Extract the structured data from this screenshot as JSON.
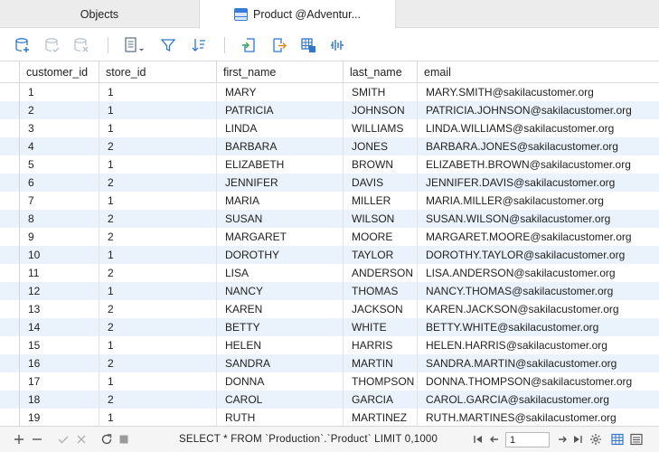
{
  "tabs": [
    {
      "label": "Objects",
      "active": false
    },
    {
      "label": "Product @Adventur...",
      "active": true
    }
  ],
  "toolbar": {
    "icons": [
      "add-record-icon",
      "save-record-icon",
      "discard-record-icon",
      "text-format-icon",
      "filter-icon",
      "sort-icon",
      "import-icon",
      "export-icon",
      "data-generator-icon",
      "chart-icon"
    ]
  },
  "table": {
    "columns": [
      "customer_id",
      "store_id",
      "first_name",
      "last_name",
      "email"
    ],
    "rows": [
      [
        "1",
        "1",
        "MARY",
        "SMITH",
        "MARY.SMITH@sakilacustomer.org"
      ],
      [
        "2",
        "1",
        "PATRICIA",
        "JOHNSON",
        "PATRICIA.JOHNSON@sakilacustomer.org"
      ],
      [
        "3",
        "1",
        "LINDA",
        "WILLIAMS",
        "LINDA.WILLIAMS@sakilacustomer.org"
      ],
      [
        "4",
        "2",
        "BARBARA",
        "JONES",
        "BARBARA.JONES@sakilacustomer.org"
      ],
      [
        "5",
        "1",
        "ELIZABETH",
        "BROWN",
        "ELIZABETH.BROWN@sakilacustomer.org"
      ],
      [
        "6",
        "2",
        "JENNIFER",
        "DAVIS",
        "JENNIFER.DAVIS@sakilacustomer.org"
      ],
      [
        "7",
        "1",
        "MARIA",
        "MILLER",
        "MARIA.MILLER@sakilacustomer.org"
      ],
      [
        "8",
        "2",
        "SUSAN",
        "WILSON",
        "SUSAN.WILSON@sakilacustomer.org"
      ],
      [
        "9",
        "2",
        "MARGARET",
        "MOORE",
        "MARGARET.MOORE@sakilacustomer.org"
      ],
      [
        "10",
        "1",
        "DOROTHY",
        "TAYLOR",
        "DOROTHY.TAYLOR@sakilacustomer.org"
      ],
      [
        "11",
        "2",
        "LISA",
        "ANDERSON",
        "LISA.ANDERSON@sakilacustomer.org"
      ],
      [
        "12",
        "1",
        "NANCY",
        "THOMAS",
        "NANCY.THOMAS@sakilacustomer.org"
      ],
      [
        "13",
        "2",
        "KAREN",
        "JACKSON",
        "KAREN.JACKSON@sakilacustomer.org"
      ],
      [
        "14",
        "2",
        "BETTY",
        "WHITE",
        "BETTY.WHITE@sakilacustomer.org"
      ],
      [
        "15",
        "1",
        "HELEN",
        "HARRIS",
        "HELEN.HARRIS@sakilacustomer.org"
      ],
      [
        "16",
        "2",
        "SANDRA",
        "MARTIN",
        "SANDRA.MARTIN@sakilacustomer.org"
      ],
      [
        "17",
        "1",
        "DONNA",
        "THOMPSON",
        "DONNA.THOMPSON@sakilacustomer.org"
      ],
      [
        "18",
        "2",
        "CAROL",
        "GARCIA",
        "CAROL.GARCIA@sakilacustomer.org"
      ],
      [
        "19",
        "1",
        "RUTH",
        "MARTINEZ",
        "RUTH.MARTINES@sakilacustomer.org"
      ]
    ]
  },
  "statusbar": {
    "sql": "SELECT * FROM `Production`.`Product` LIMIT 0,1000",
    "page_value": "1"
  },
  "colors": {
    "accent": "#3a7bd5",
    "alt_row": "#eaf2fb",
    "toolbar_icon": "#2f77c9"
  }
}
